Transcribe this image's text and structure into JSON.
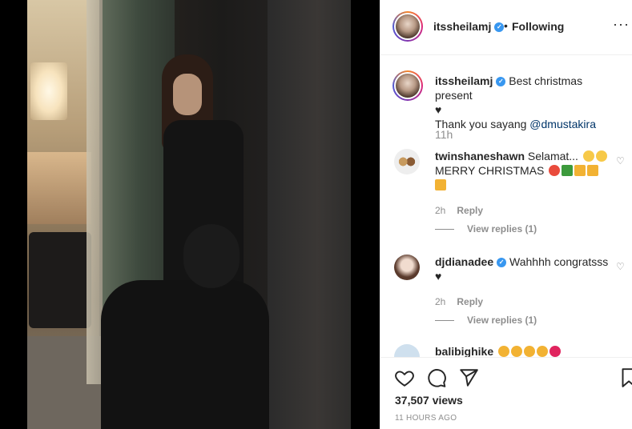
{
  "post": {
    "username": "itssheilamj",
    "follow_status": "Following",
    "more_icon": "more-horizontal-icon",
    "caption_line1": "Best christmas present",
    "caption_heart": "♥",
    "caption_line2_prefix": "Thank you sayang ",
    "caption_mention": "@dmustakira",
    "caption_time": "11h"
  },
  "comments": [
    {
      "username": "twinshaneshawn",
      "text_line1": "Selamat...",
      "text_line2": "MERRY CHRISTMAS",
      "time": "2h",
      "reply_label": "Reply",
      "view_replies": "View replies (1)"
    },
    {
      "username": "djdianadee",
      "text_line1": "Wahhhh congratsss",
      "text_line2": "♥",
      "time": "2h",
      "reply_label": "Reply",
      "view_replies": "View replies (1)"
    },
    {
      "username": "balibighike"
    }
  ],
  "actions": {
    "like_icon": "heart-icon",
    "comment_icon": "comment-icon",
    "share_icon": "share-icon",
    "save_icon": "bookmark-icon"
  },
  "stats": {
    "views": "37,507 views",
    "posted": "11 HOURS AGO"
  },
  "colors": {
    "verified": "#3897f0",
    "mention": "#003569",
    "muted": "#8e8e8e"
  }
}
